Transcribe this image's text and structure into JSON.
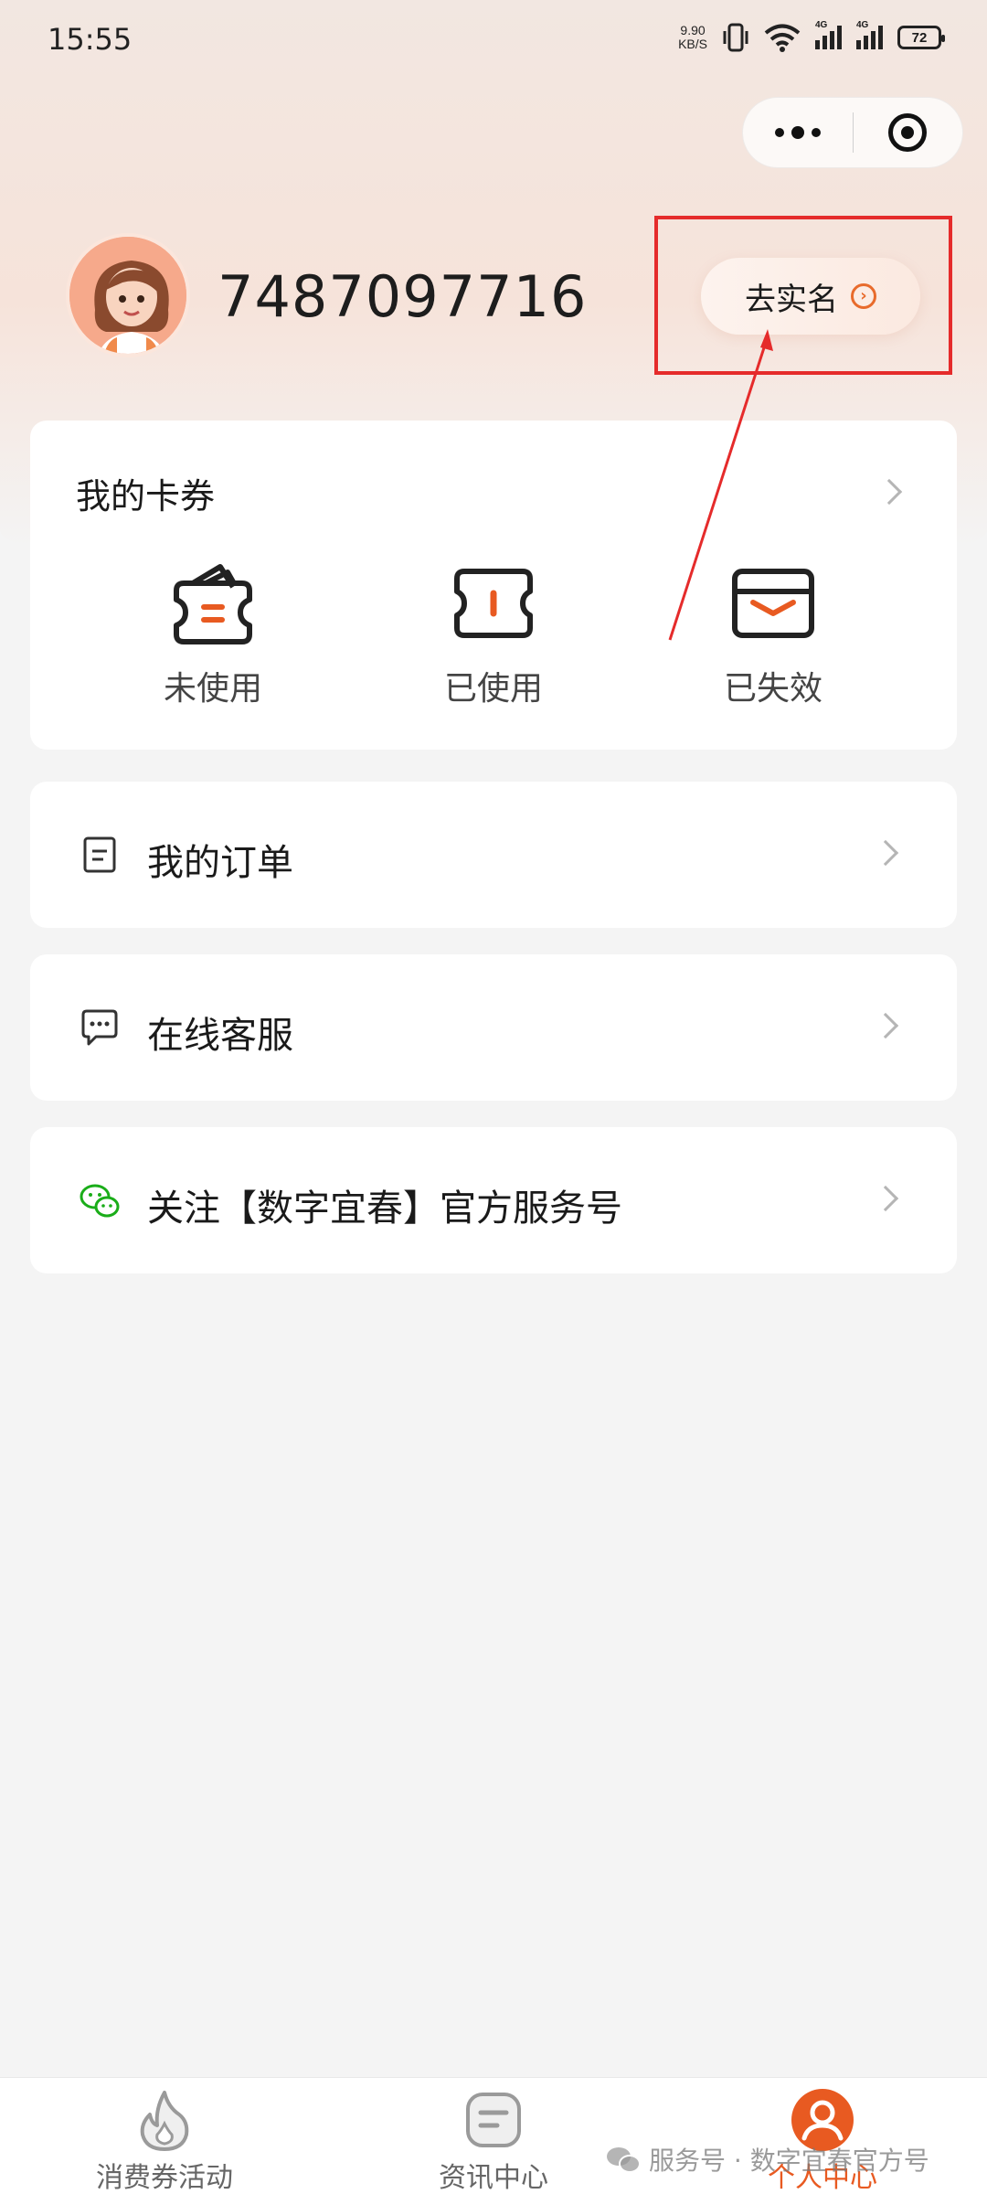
{
  "status_bar": {
    "time": "15:55",
    "net_speed_value": "9.90",
    "net_speed_unit": "KB/S",
    "signal_label": "4G",
    "battery": "72"
  },
  "profile": {
    "user_id": "7487097716",
    "realname_button": "去实名"
  },
  "coupons": {
    "title": "我的卡券",
    "items": [
      {
        "label": "未使用",
        "icon": "wallet-icon"
      },
      {
        "label": "已使用",
        "icon": "ticket-icon"
      },
      {
        "label": "已失效",
        "icon": "expired-card-icon"
      }
    ]
  },
  "menu": {
    "orders": "我的订单",
    "service": "在线客服",
    "follow": "关注【数字宜春】官方服务号"
  },
  "tabbar": {
    "tabs": [
      {
        "label": "消费券活动",
        "icon": "flame-icon"
      },
      {
        "label": "资讯中心",
        "icon": "news-icon"
      },
      {
        "label": "个人中心",
        "icon": "user-icon"
      }
    ],
    "active_color": "#e85a21"
  },
  "watermark": "服务号 · 数字宜春官方号",
  "colors": {
    "accent": "#e85a21",
    "annotation": "#e52b2b",
    "wechat_green": "#1aad19"
  }
}
